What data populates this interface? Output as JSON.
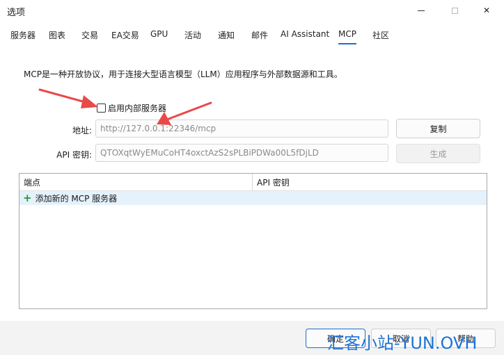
{
  "window": {
    "title": "选项",
    "min_icon": "minimize-icon",
    "max_icon": "maximize-icon",
    "close_icon": "close-icon",
    "close_glyph": "✕"
  },
  "tabs": [
    {
      "label": "服务器"
    },
    {
      "label": "图表"
    },
    {
      "label": "交易"
    },
    {
      "label": "EA交易"
    },
    {
      "label": "GPU"
    },
    {
      "label": "活动"
    },
    {
      "label": "通知"
    },
    {
      "label": "邮件"
    },
    {
      "label": "AI Assistant"
    },
    {
      "label": "MCP",
      "active": true
    },
    {
      "label": "社区"
    }
  ],
  "mcp": {
    "description": "MCP是一种开放协议，用于连接大型语言模型（LLM）应用程序与外部数据源和工具。",
    "enable_internal_server": {
      "label": "启用内部服务器",
      "checked": false
    },
    "address": {
      "label": "地址:",
      "value": "http://127.0.0.1:22346/mcp",
      "button": "复制"
    },
    "api_key": {
      "label": "API 密钥:",
      "value": "QTOXqtWyEMuCoHT4oxctAzS2sPLBiPDWa00L5fDjLD",
      "button": "生成"
    },
    "table": {
      "columns": [
        "端点",
        "API 密钥"
      ],
      "add_row": {
        "icon": "plus-icon",
        "glyph": "+",
        "label": "添加新的 MCP 服务器"
      }
    }
  },
  "footer": {
    "ok": "确定",
    "cancel": "取消",
    "help": "帮助"
  },
  "watermark": "汇客小站-YUN.OVH",
  "colors": {
    "accent": "#1a6fd0",
    "annotation_arrow": "#e84a4a",
    "add_icon": "#1f9a3a",
    "selected_row": "#e5f1fb"
  }
}
